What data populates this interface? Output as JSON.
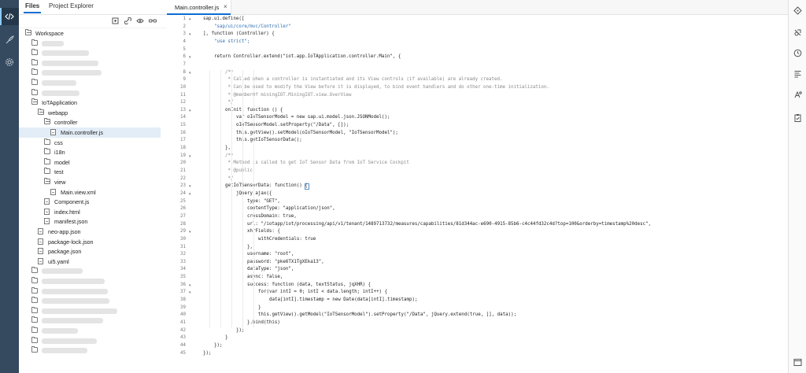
{
  "left_bar": {
    "icons": [
      "code-icon",
      "rocket-icon",
      "gear-icon"
    ]
  },
  "file_pane": {
    "tabs": [
      "Files",
      "Project Explorer"
    ],
    "toolbar_icons": [
      "new-file-icon",
      "link-icon",
      "eye-icon",
      "glasses-icon"
    ],
    "tree": [
      {
        "label": "Workspace",
        "type": "folder-open",
        "depth": 0
      },
      {
        "label": "",
        "type": "folder",
        "depth": 1,
        "blurred": true,
        "blur_w": 28
      },
      {
        "label": "",
        "type": "folder",
        "depth": 1,
        "blurred": true,
        "blur_w": 60
      },
      {
        "label": "",
        "type": "folder",
        "depth": 1,
        "blurred": true,
        "blur_w": 72
      },
      {
        "label": "",
        "type": "folder",
        "depth": 1,
        "blurred": true,
        "blur_w": 76
      },
      {
        "label": "",
        "type": "folder",
        "depth": 1,
        "blurred": true,
        "blur_w": 44
      },
      {
        "label": "",
        "type": "folder",
        "depth": 1,
        "blurred": true,
        "blur_w": 48
      },
      {
        "label": "IoTApplication",
        "type": "folder-open",
        "depth": 1
      },
      {
        "label": "webapp",
        "type": "folder-open",
        "depth": 2
      },
      {
        "label": "controller",
        "type": "folder-open",
        "depth": 3
      },
      {
        "label": "Main.controller.js",
        "type": "file",
        "depth": 4,
        "selected": true
      },
      {
        "label": "css",
        "type": "folder",
        "depth": 3
      },
      {
        "label": "i18n",
        "type": "folder",
        "depth": 3
      },
      {
        "label": "model",
        "type": "folder",
        "depth": 3
      },
      {
        "label": "test",
        "type": "folder",
        "depth": 3
      },
      {
        "label": "view",
        "type": "folder-open",
        "depth": 3
      },
      {
        "label": "Main.view.xml",
        "type": "file",
        "depth": 4
      },
      {
        "label": "Component.js",
        "type": "file",
        "depth": 3
      },
      {
        "label": "index.html",
        "type": "file",
        "depth": 3
      },
      {
        "label": "manifest.json",
        "type": "file",
        "depth": 3
      },
      {
        "label": "neo-app.json",
        "type": "file",
        "depth": 2
      },
      {
        "label": "package-lock.json",
        "type": "file",
        "depth": 2
      },
      {
        "label": "package.json",
        "type": "file",
        "depth": 2
      },
      {
        "label": "ui5.yaml",
        "type": "file",
        "depth": 2
      },
      {
        "label": "",
        "type": "folder",
        "depth": 1,
        "blurred": true,
        "blur_w": 52
      },
      {
        "label": "",
        "type": "folder",
        "depth": 1,
        "blurred": true,
        "blur_w": 80
      },
      {
        "label": "",
        "type": "folder",
        "depth": 1,
        "blurred": true,
        "blur_w": 84
      },
      {
        "label": "",
        "type": "folder",
        "depth": 1,
        "blurred": true,
        "blur_w": 86
      },
      {
        "label": "",
        "type": "folder",
        "depth": 1,
        "blurred": true,
        "blur_w": 96
      },
      {
        "label": "",
        "type": "folder",
        "depth": 1,
        "blurred": true,
        "blur_w": 78
      },
      {
        "label": "",
        "type": "folder",
        "depth": 1,
        "blurred": true,
        "blur_w": 46
      },
      {
        "label": "",
        "type": "folder",
        "depth": 1,
        "blurred": true,
        "blur_w": 70
      },
      {
        "label": "",
        "type": "folder",
        "depth": 1,
        "blurred": true,
        "blur_w": 58
      }
    ]
  },
  "editor": {
    "tab_label": "Main.controller.js",
    "tab_close": "×",
    "lines": [
      {
        "n": "1",
        "fold": "▾",
        "ind": 0,
        "text": "sap.ui.define(["
      },
      {
        "n": "2",
        "ind": 1,
        "text": "\"sap/ui/core/mvc/Controller\"",
        "cls": "str"
      },
      {
        "n": "3",
        "fold": "▾",
        "ind": 0,
        "text": "], function (Controller) {"
      },
      {
        "n": "4",
        "ind": 1,
        "text": "\"use strict\";",
        "cls": "str"
      },
      {
        "n": "5",
        "ind": 0,
        "text": ""
      },
      {
        "n": "6",
        "fold": "▾",
        "ind": 1,
        "text": "return Controller.extend(\"iot.app.IoTApplication.controller.Main\", {"
      },
      {
        "n": "7",
        "ind": 0,
        "text": ""
      },
      {
        "n": "8",
        "fold": "▾",
        "ind": 2,
        "text": "/**",
        "cls": "cmt"
      },
      {
        "n": "9",
        "ind": 2,
        "text": " * Called when a controller is instantiated and its View controls (if available) are already created.",
        "cls": "cmt"
      },
      {
        "n": "10",
        "ind": 2,
        "text": " * Can be used to modify the View before it is displayed, to bind event handlers and do other one-time initialization.",
        "cls": "cmt"
      },
      {
        "n": "11",
        "ind": 2,
        "text": " * @memberOf miningIOT.MiningIOT.view.OverView",
        "cls": "cmt"
      },
      {
        "n": "12",
        "ind": 2,
        "text": " */",
        "cls": "cmt"
      },
      {
        "n": "13",
        "fold": "▾",
        "ind": 2,
        "text": "onInit: function () {"
      },
      {
        "n": "14",
        "ind": 3,
        "text": "var oIoTSensorModel = new sap.ui.model.json.JSONModel();"
      },
      {
        "n": "15",
        "ind": 3,
        "text": "oIoTSensorModel.setProperty(\"/Data\", []);"
      },
      {
        "n": "16",
        "ind": 3,
        "text": "this.getView().setModel(oIoTSensorModel, \"IoTSensorModel\");"
      },
      {
        "n": "17",
        "ind": 3,
        "text": "this.getIoTSensorData();"
      },
      {
        "n": "18",
        "ind": 2,
        "text": "},"
      },
      {
        "n": "19",
        "fold": "▾",
        "ind": 2,
        "text": "/**",
        "cls": "cmt"
      },
      {
        "n": "20",
        "ind": 2,
        "text": " * Method is called to get IoT Sensor Data from IoT Service Cockpit",
        "cls": "cmt"
      },
      {
        "n": "21",
        "ind": 2,
        "text": " * @public",
        "cls": "cmt"
      },
      {
        "n": "22",
        "ind": 2,
        "text": " */",
        "cls": "cmt"
      },
      {
        "n": "23",
        "fold": "▾",
        "ind": 2,
        "text": "getIoTSensorData: function() {",
        "brk": true
      },
      {
        "n": "24",
        "fold": "▾",
        "ind": 3,
        "text": "jQuery.ajax({"
      },
      {
        "n": "25",
        "ind": 4,
        "text": "type: \"GET\","
      },
      {
        "n": "26",
        "ind": 4,
        "text": "contentType: \"application/json\","
      },
      {
        "n": "27",
        "ind": 4,
        "text": "crossDomain: true,"
      },
      {
        "n": "28",
        "ind": 4,
        "text": "url: \"/iotapp/iot/processing/api/v1/tenant/1489713732/measures/capabilities/81d344ac-e690-4915-85b6-c4c44fd32c4d?top=100&orderby=timestamp%20desc\","
      },
      {
        "n": "29",
        "fold": "▾",
        "ind": 4,
        "text": "xhrFields: {"
      },
      {
        "n": "30",
        "ind": 5,
        "text": "withCredentials: true"
      },
      {
        "n": "31",
        "ind": 4,
        "text": "},"
      },
      {
        "n": "32",
        "ind": 4,
        "text": "username: \"root\","
      },
      {
        "n": "33",
        "ind": 4,
        "text": "password: \"pke6TX1TgXEka13\","
      },
      {
        "n": "34",
        "ind": 4,
        "text": "dataType: \"json\","
      },
      {
        "n": "35",
        "ind": 4,
        "text": "async: false,"
      },
      {
        "n": "36",
        "fold": "▾",
        "ind": 4,
        "text": "success: function (data, textStatus, jqXHR) {"
      },
      {
        "n": "37",
        "fold": "▾",
        "ind": 5,
        "text": "for(var intI = 0; intI < data.length; intI++) {"
      },
      {
        "n": "38",
        "ind": 6,
        "text": "data[intI].timestamp = new Date(data[intI].timestamp);"
      },
      {
        "n": "39",
        "ind": 5,
        "text": "}"
      },
      {
        "n": "40",
        "ind": 5,
        "text": "this.getView().getModel(\"IoTSensorModel\").setProperty(\"/Data\", jQuery.extend(true, [], data));"
      },
      {
        "n": "41",
        "ind": 4,
        "text": "}.bind(this)"
      },
      {
        "n": "42",
        "ind": 3,
        "text": "});"
      },
      {
        "n": "43",
        "ind": 2,
        "text": "}"
      },
      {
        "n": "44",
        "ind": 1,
        "text": "});"
      },
      {
        "n": "45",
        "ind": 0,
        "text": "});"
      }
    ]
  },
  "right_bar": {
    "icons": [
      "git-icon",
      "debug-icon",
      "history-icon",
      "outline-icon",
      "api-icon",
      "clipboard-check-icon",
      "console-icon"
    ]
  }
}
